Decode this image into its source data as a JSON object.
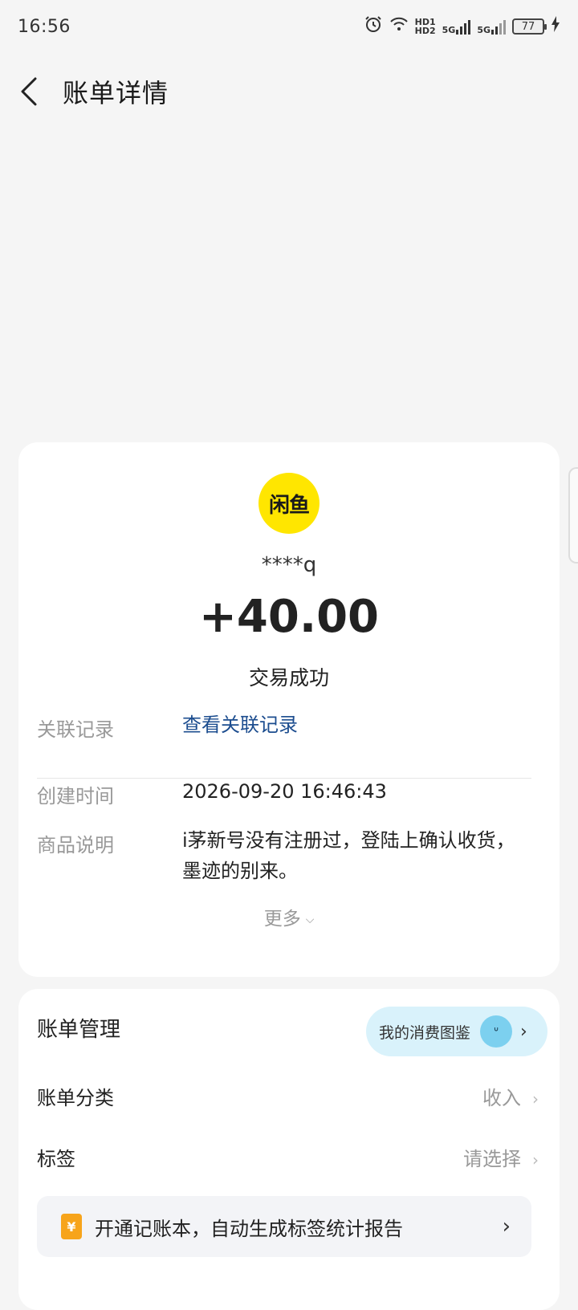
{
  "status_bar": {
    "time": "16:56",
    "hd1": "HD1",
    "hd2": "HD2",
    "net1": "5G",
    "net2": "5G",
    "battery": "77",
    "icons": [
      "alarm-icon",
      "wifi-icon",
      "signal-icon",
      "battery-icon",
      "charging-icon"
    ]
  },
  "nav": {
    "title": "账单详情",
    "back_icon": "chevron-left-icon"
  },
  "transaction": {
    "merchant_logo_text": "闲鱼",
    "logo_color": "#ffe600",
    "payer": "****q",
    "amount": "+40.00",
    "status": "交易成功"
  },
  "details": {
    "related_label": "关联记录",
    "related_link": "查看关联记录",
    "created_label": "创建时间",
    "created_value": "2026-09-20 16:46:43",
    "desc_label": "商品说明",
    "desc_value_line1": "i茅新号没有注册过，登陆上确认收货，",
    "desc_value_line2": "墨迹的别来。",
    "more": "更多"
  },
  "manage": {
    "title": "账单管理",
    "pill_label": "我的消费图鉴",
    "category_label": "账单分类",
    "category_value": "收入",
    "tag_label": "标签",
    "tag_value": "请选择",
    "banner_text": "开通记账本，自动生成标签统计报告",
    "banner_icon_text": "¥"
  },
  "colors": {
    "link": "#1c4d8f",
    "pill_bg": "#d9f2fb",
    "banner_icon": "#f7a41b"
  }
}
